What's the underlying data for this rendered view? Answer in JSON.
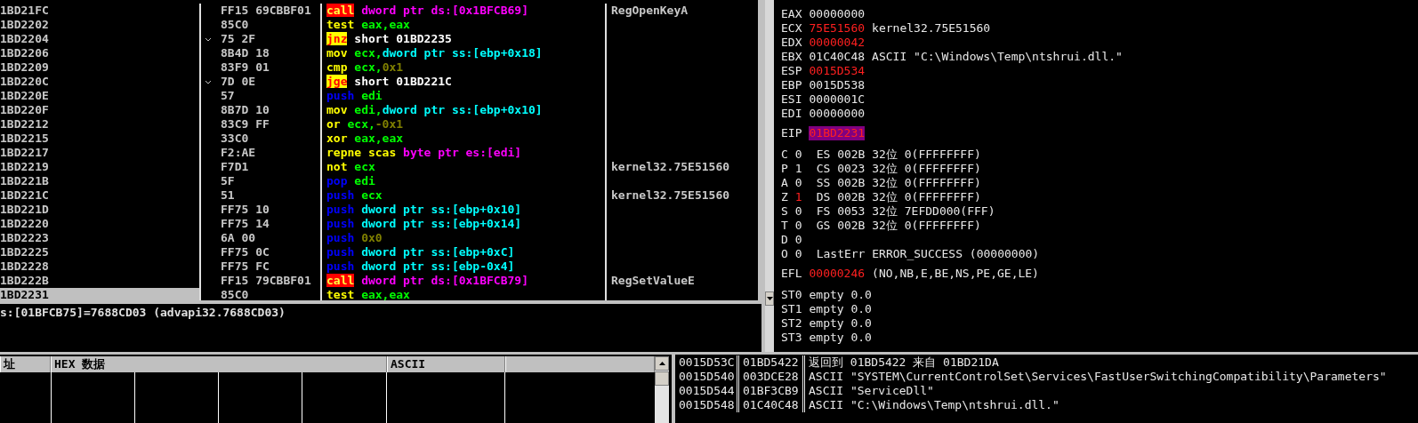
{
  "disassembly": {
    "rows": [
      {
        "address": "1BD21FC",
        "hex": "FF15 69CBBF01",
        "jump_mark": false,
        "selected": false,
        "code": [
          {
            "text": "call",
            "kind": "call"
          },
          {
            "text": " dword ptr ds:[0x1BFCB69]",
            "kind": "ds"
          }
        ],
        "comment": "RegOpenKeyA"
      },
      {
        "address": "1BD2202",
        "hex": "85C0",
        "jump_mark": false,
        "selected": false,
        "code": [
          {
            "text": "test",
            "kind": "op"
          },
          {
            "text": " eax,eax",
            "kind": "reg"
          }
        ]
      },
      {
        "address": "1BD2204",
        "hex": "75 2F",
        "jump_mark": true,
        "selected": false,
        "code": [
          {
            "text": "jnz",
            "kind": "jcc"
          },
          {
            "text": " short 01BD2235",
            "kind": "target"
          }
        ]
      },
      {
        "address": "1BD2206",
        "hex": "8B4D 18",
        "jump_mark": false,
        "selected": false,
        "code": [
          {
            "text": "mov",
            "kind": "op"
          },
          {
            "text": " ecx,",
            "kind": "reg"
          },
          {
            "text": "dword ptr ss:[ebp+0x18]",
            "kind": "ss"
          }
        ]
      },
      {
        "address": "1BD2209",
        "hex": "83F9 01",
        "jump_mark": false,
        "selected": false,
        "code": [
          {
            "text": "cmp",
            "kind": "op"
          },
          {
            "text": " ecx,",
            "kind": "reg"
          },
          {
            "text": "0x1",
            "kind": "imm"
          }
        ]
      },
      {
        "address": "1BD220C",
        "hex": "7D 0E",
        "jump_mark": true,
        "selected": false,
        "code": [
          {
            "text": "jge",
            "kind": "jcc"
          },
          {
            "text": " short 01BD221C",
            "kind": "target"
          }
        ]
      },
      {
        "address": "1BD220E",
        "hex": "57",
        "jump_mark": false,
        "selected": false,
        "code": [
          {
            "text": "push",
            "kind": "stack"
          },
          {
            "text": " edi",
            "kind": "reg"
          }
        ]
      },
      {
        "address": "1BD220F",
        "hex": "8B7D 10",
        "jump_mark": false,
        "selected": false,
        "code": [
          {
            "text": "mov",
            "kind": "op"
          },
          {
            "text": " edi,",
            "kind": "reg"
          },
          {
            "text": "dword ptr ss:[ebp+0x10]",
            "kind": "ss"
          }
        ]
      },
      {
        "address": "1BD2212",
        "hex": "83C9 FF",
        "jump_mark": false,
        "selected": false,
        "code": [
          {
            "text": "or",
            "kind": "op"
          },
          {
            "text": " ecx,",
            "kind": "reg"
          },
          {
            "text": "-0x1",
            "kind": "imm"
          }
        ]
      },
      {
        "address": "1BD2215",
        "hex": "33C0",
        "jump_mark": false,
        "selected": false,
        "code": [
          {
            "text": "xor",
            "kind": "op"
          },
          {
            "text": " eax,eax",
            "kind": "reg"
          }
        ]
      },
      {
        "address": "1BD2217",
        "hex": "F2:AE",
        "jump_mark": false,
        "selected": false,
        "code": [
          {
            "text": "repne scas",
            "kind": "op"
          },
          {
            "text": " byte ptr es:[edi]",
            "kind": "ds"
          }
        ]
      },
      {
        "address": "1BD2219",
        "hex": "F7D1",
        "jump_mark": false,
        "selected": false,
        "code": [
          {
            "text": "not",
            "kind": "op"
          },
          {
            "text": " ecx",
            "kind": "reg"
          }
        ],
        "comment": "kernel32.75E51560"
      },
      {
        "address": "1BD221B",
        "hex": "5F",
        "jump_mark": false,
        "selected": false,
        "code": [
          {
            "text": "pop",
            "kind": "stack"
          },
          {
            "text": " edi",
            "kind": "reg"
          }
        ]
      },
      {
        "address": "1BD221C",
        "hex": "51",
        "jump_mark": false,
        "selected": false,
        "code": [
          {
            "text": "push",
            "kind": "stack"
          },
          {
            "text": " ecx",
            "kind": "reg"
          }
        ],
        "comment": "kernel32.75E51560"
      },
      {
        "address": "1BD221D",
        "hex": "FF75 10",
        "jump_mark": false,
        "selected": false,
        "code": [
          {
            "text": "push",
            "kind": "stack"
          },
          {
            "text": " dword ptr ss:[ebp+0x10]",
            "kind": "ss"
          }
        ]
      },
      {
        "address": "1BD2220",
        "hex": "FF75 14",
        "jump_mark": false,
        "selected": false,
        "code": [
          {
            "text": "push",
            "kind": "stack"
          },
          {
            "text": " dword ptr ss:[ebp+0x14]",
            "kind": "ss"
          }
        ]
      },
      {
        "address": "1BD2223",
        "hex": "6A 00",
        "jump_mark": false,
        "selected": false,
        "code": [
          {
            "text": "push",
            "kind": "stack"
          },
          {
            "text": " 0x0",
            "kind": "imm"
          }
        ]
      },
      {
        "address": "1BD2225",
        "hex": "FF75 0C",
        "jump_mark": false,
        "selected": false,
        "code": [
          {
            "text": "push",
            "kind": "stack"
          },
          {
            "text": " dword ptr ss:[ebp+0xC]",
            "kind": "ss"
          }
        ]
      },
      {
        "address": "1BD2228",
        "hex": "FF75 FC",
        "jump_mark": false,
        "selected": false,
        "code": [
          {
            "text": "push",
            "kind": "stack"
          },
          {
            "text": " dword ptr ss:[ebp-0x4]",
            "kind": "ss"
          }
        ]
      },
      {
        "address": "1BD222B",
        "hex": "FF15 79CBBF01",
        "jump_mark": false,
        "selected": false,
        "code": [
          {
            "text": "call",
            "kind": "call"
          },
          {
            "text": " dword ptr ds:[0x1BFCB79]",
            "kind": "ds"
          }
        ],
        "comment": "RegSetValueE"
      },
      {
        "address": "1BD2231",
        "hex": "85C0",
        "jump_mark": false,
        "selected": true,
        "code": [
          {
            "text": "test",
            "kind": "op"
          },
          {
            "text": " eax,eax",
            "kind": "reg"
          }
        ]
      }
    ]
  },
  "info": {
    "text": "s:[01BFCB75]=7688CD03 (advapi32.7688CD03)"
  },
  "registers": {
    "general": [
      {
        "name": "EAX",
        "value": "00000000",
        "changed": false
      },
      {
        "name": "ECX",
        "value": "75E51560",
        "changed": true,
        "comment": "kernel32.75E51560"
      },
      {
        "name": "EDX",
        "value": "00000042",
        "changed": true
      },
      {
        "name": "EBX",
        "value": "01C40C48",
        "changed": false,
        "comment": "ASCII \"C:\\Windows\\Temp\\ntshrui.dll.\""
      },
      {
        "name": "ESP",
        "value": "0015D534",
        "changed": true
      },
      {
        "name": "EBP",
        "value": "0015D538",
        "changed": false
      },
      {
        "name": "ESI",
        "value": "0000001C",
        "changed": false
      },
      {
        "name": "EDI",
        "value": "00000000",
        "changed": false
      }
    ],
    "eip": {
      "name": "EIP",
      "value": "01BD2231",
      "changed": true
    },
    "flags": [
      {
        "flag": "C",
        "value": "0",
        "changed": false,
        "detail": "ES 002B 32位 0(FFFFFFFF)"
      },
      {
        "flag": "P",
        "value": "1",
        "changed": false,
        "detail": "CS 0023 32位 0(FFFFFFFF)"
      },
      {
        "flag": "A",
        "value": "0",
        "changed": false,
        "detail": "SS 002B 32位 0(FFFFFFFF)"
      },
      {
        "flag": "Z",
        "value": "1",
        "changed": true,
        "detail": "DS 002B 32位 0(FFFFFFFF)"
      },
      {
        "flag": "S",
        "value": "0",
        "changed": false,
        "detail": "FS 0053 32位 7EFDD000(FFF)"
      },
      {
        "flag": "T",
        "value": "0",
        "changed": false,
        "detail": "GS 002B 32位 0(FFFFFFFF)"
      },
      {
        "flag": "D",
        "value": "0",
        "changed": false
      },
      {
        "flag": "O",
        "value": "0",
        "changed": false,
        "detail": "LastErr ERROR_SUCCESS (00000000)"
      }
    ],
    "efl": {
      "name": "EFL",
      "value": "00000246",
      "changed": true,
      "decoded": "(NO,NB,E,BE,NS,PE,GE,LE)"
    },
    "fpu": [
      {
        "name": "ST0",
        "value": "empty 0.0"
      },
      {
        "name": "ST1",
        "value": "empty 0.0"
      },
      {
        "name": "ST2",
        "value": "empty 0.0"
      },
      {
        "name": "ST3",
        "value": "empty 0.0"
      }
    ]
  },
  "dump": {
    "columns": [
      "址",
      "HEX 数据",
      "ASCII"
    ]
  },
  "stack": {
    "rows": [
      {
        "address": "0015D53C",
        "value": "01BD5422",
        "comment": "返回到 01BD5422 来自 01BD21DA"
      },
      {
        "address": "0015D540",
        "value": "003DCE28",
        "comment": "ASCII \"SYSTEM\\CurrentControlSet\\Services\\FastUserSwitchingCompatibility\\Parameters\""
      },
      {
        "address": "0015D544",
        "value": "01BF3CB9",
        "comment": "ASCII \"ServiceDll\""
      },
      {
        "address": "0015D548",
        "value": "01C40C48",
        "comment": "ASCII \"C:\\Windows\\Temp\\ntshrui.dll.\""
      }
    ]
  }
}
